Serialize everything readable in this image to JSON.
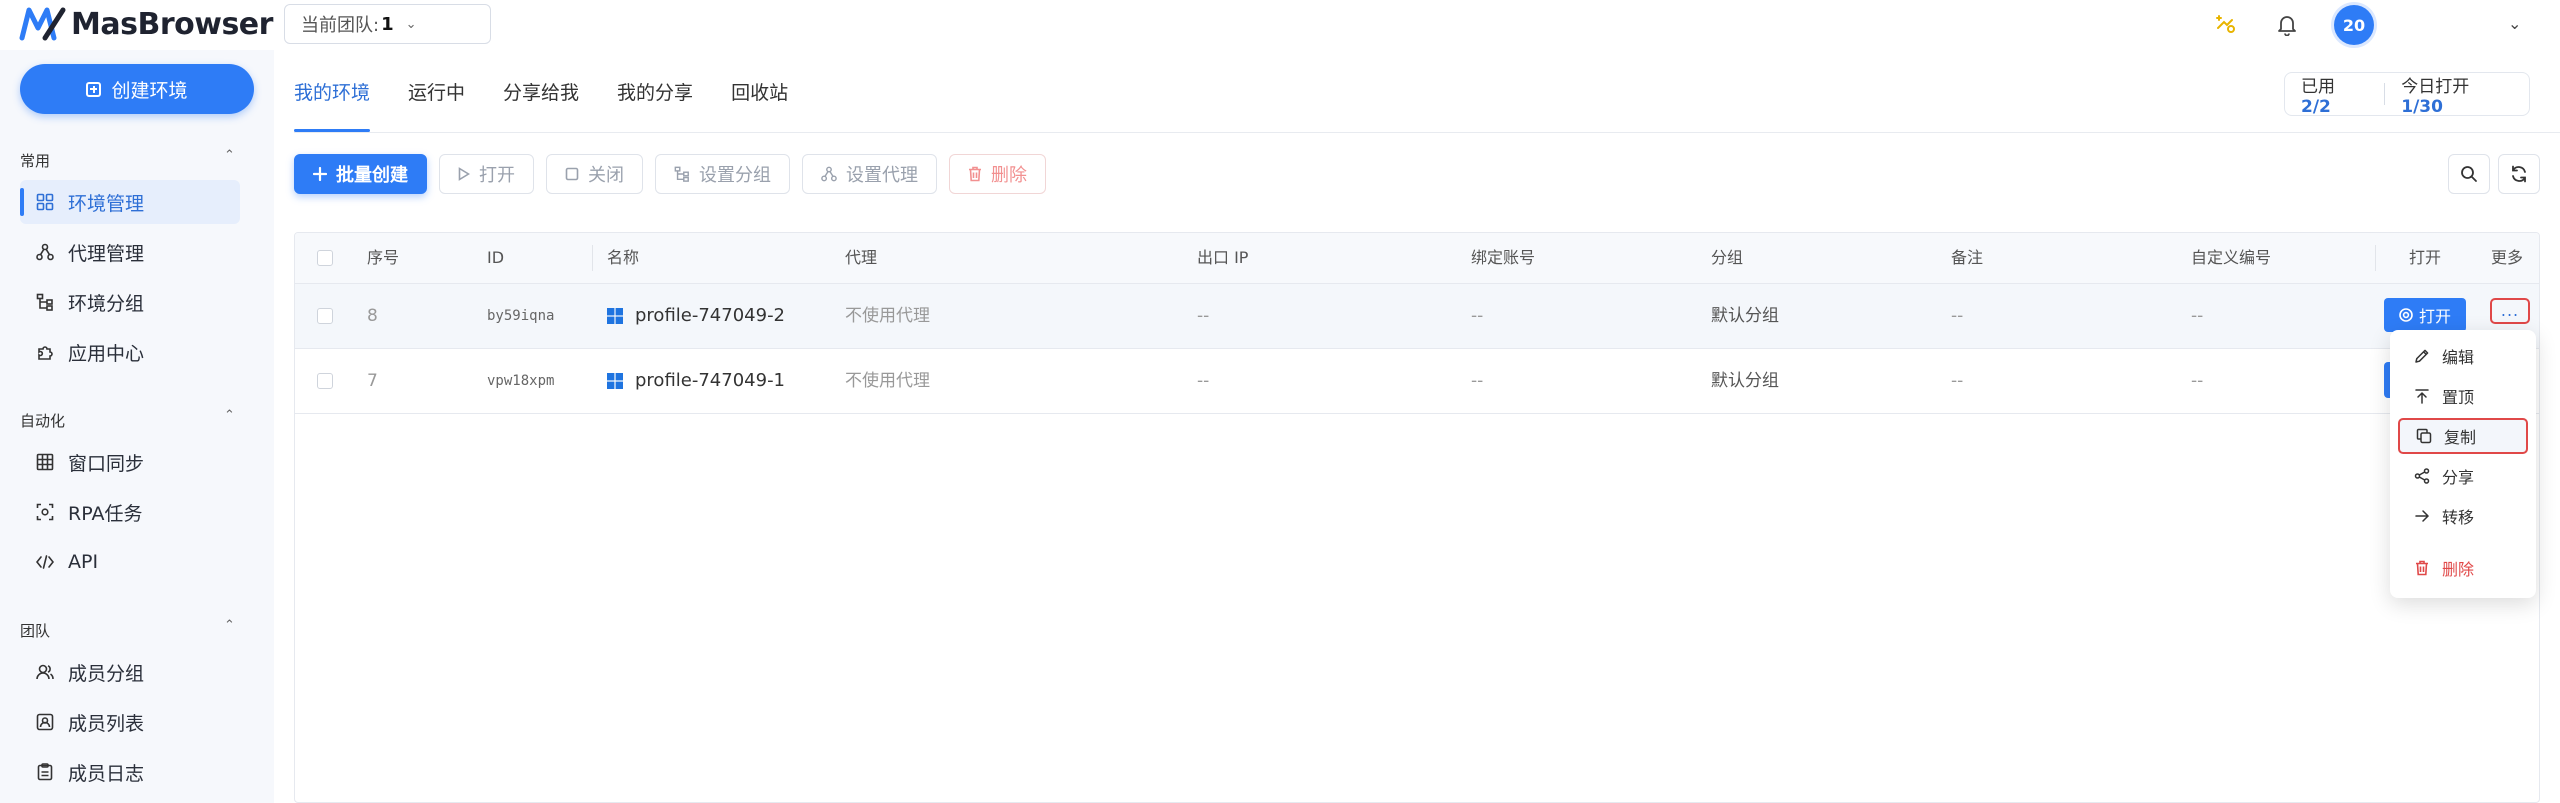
{
  "brand": {
    "name": "MasBrowser",
    "accent": "#2e7cf6"
  },
  "header": {
    "team_label": "当前团队:",
    "team_value": "1",
    "avatar_text": "20"
  },
  "sidebar": {
    "create_label": "创建环境",
    "sections": [
      {
        "title": "常用",
        "items": [
          {
            "label": "环境管理",
            "icon": "grid-icon",
            "active": true
          },
          {
            "label": "代理管理",
            "icon": "network-icon"
          },
          {
            "label": "环境分组",
            "icon": "tree-icon"
          },
          {
            "label": "应用中心",
            "icon": "puzzle-icon"
          }
        ]
      },
      {
        "title": "自动化",
        "items": [
          {
            "label": "窗口同步",
            "icon": "table-icon"
          },
          {
            "label": "RPA任务",
            "icon": "robot-icon"
          },
          {
            "label": "API",
            "icon": "code-icon"
          }
        ]
      },
      {
        "title": "团队",
        "items": [
          {
            "label": "成员分组",
            "icon": "users-icon"
          },
          {
            "label": "成员列表",
            "icon": "id-card-icon"
          },
          {
            "label": "成员日志",
            "icon": "clipboard-icon"
          }
        ]
      }
    ]
  },
  "tabs": [
    "我的环境",
    "运行中",
    "分享给我",
    "我的分享",
    "回收站"
  ],
  "usage": {
    "used_label": "已用",
    "used_value": "2/2",
    "today_label": "今日打开",
    "today_value": "1/30"
  },
  "toolbar": {
    "batch_create": "批量创建",
    "open": "打开",
    "close": "关闭",
    "set_group": "设置分组",
    "set_proxy": "设置代理",
    "delete": "删除"
  },
  "table": {
    "columns": {
      "index": "序号",
      "id": "ID",
      "name": "名称",
      "proxy": "代理",
      "exit_ip": "出口 IP",
      "account": "绑定账号",
      "group": "分组",
      "note": "备注",
      "custom_no": "自定义编号",
      "open": "打开",
      "more": "更多"
    },
    "rows": [
      {
        "index": "8",
        "id": "by59iqna",
        "name": "profile-747049-2",
        "proxy": "不使用代理",
        "exit_ip": "--",
        "account": "--",
        "group": "默认分组",
        "note": "--",
        "custom_no": "--"
      },
      {
        "index": "7",
        "id": "vpw18xpm",
        "name": "profile-747049-1",
        "proxy": "不使用代理",
        "exit_ip": "--",
        "account": "--",
        "group": "默认分组",
        "note": "--",
        "custom_no": "--"
      }
    ],
    "open_button": "打开",
    "more_button": "..."
  },
  "context_menu": {
    "items": [
      "编辑",
      "置顶",
      "复制",
      "分享",
      "转移",
      "删除"
    ]
  }
}
